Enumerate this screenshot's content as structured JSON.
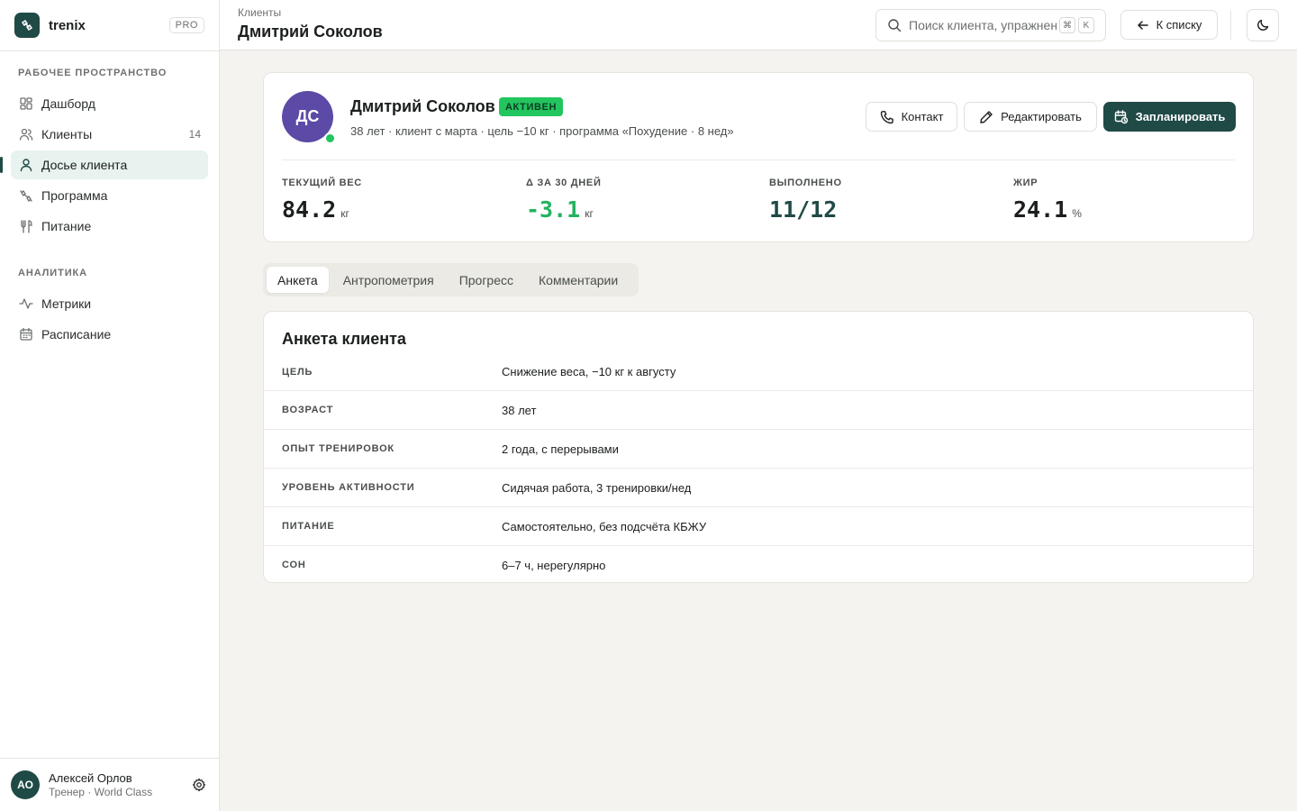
{
  "brand": {
    "name": "trenix",
    "badge": "PRO"
  },
  "sidebar": {
    "sections": [
      {
        "title": "РАБОЧЕЕ ПРОСТРАНСТВО",
        "items": [
          {
            "label": "Дашборд",
            "icon": "dashboard-icon"
          },
          {
            "label": "Клиенты",
            "icon": "users-icon",
            "count": "14"
          },
          {
            "label": "Досье клиента",
            "icon": "user-icon",
            "active": true
          },
          {
            "label": "Программа",
            "icon": "dumbbell-icon"
          },
          {
            "label": "Питание",
            "icon": "fork-knife-icon"
          }
        ]
      },
      {
        "title": "АНАЛИТИКА",
        "items": [
          {
            "label": "Метрики",
            "icon": "activity-icon"
          },
          {
            "label": "Расписание",
            "icon": "calendar-icon"
          }
        ]
      }
    ],
    "user": {
      "initials": "АО",
      "name": "Алексей Орлов",
      "role": "Тренер · World Class"
    }
  },
  "topbar": {
    "breadcrumb": "Клиенты",
    "title": "Дмитрий Соколов",
    "search_placeholder": "Поиск клиента, упражнения…",
    "kbd_cmd": "⌘",
    "kbd_key": "K",
    "back_label": "К списку"
  },
  "profile": {
    "initials": "ДС",
    "name": "Дмитрий Соколов",
    "status": "АКТИВЕН",
    "subtitle": "38 лет · клиент с марта · цель −10 кг · программа «Похудение · 8 нед»",
    "buttons": {
      "contact": "Контакт",
      "edit": "Редактировать",
      "schedule": "Запланировать"
    },
    "stats": [
      {
        "label": "ТЕКУЩИЙ ВЕС",
        "value": "84.2",
        "unit": "кг"
      },
      {
        "label": "Δ ЗА 30 ДНЕЙ",
        "value": "-3.1",
        "unit": "кг"
      },
      {
        "label": "ВЫПОЛНЕНО",
        "value": "11/12",
        "unit": ""
      },
      {
        "label": "ЖИР",
        "value": "24.1",
        "unit": "%"
      }
    ]
  },
  "tabs": [
    {
      "label": "Анкета",
      "active": true
    },
    {
      "label": "Антропометрия"
    },
    {
      "label": "Прогресс"
    },
    {
      "label": "Комментарии"
    }
  ],
  "questionnaire": {
    "title": "Анкета клиента",
    "rows": [
      {
        "label": "ЦЕЛЬ",
        "value": "Снижение веса, −10 кг к августу"
      },
      {
        "label": "ВОЗРАСТ",
        "value": "38 лет"
      },
      {
        "label": "ОПЫТ ТРЕНИРОВОК",
        "value": "2 года, с перерывами"
      },
      {
        "label": "УРОВЕНЬ АКТИВНОСТИ",
        "value": "Сидячая работа, 3 тренировки/нед"
      },
      {
        "label": "ПИТАНИЕ",
        "value": "Самостоятельно, без подсчёта КБЖУ"
      },
      {
        "label": "СОН",
        "value": "6–7 ч, нерегулярно"
      }
    ]
  },
  "colors": {
    "brand": "#1f4a45",
    "success": "#22c55e",
    "avatar": "#5c4aa6",
    "page_bg": "#f4f3ef"
  }
}
